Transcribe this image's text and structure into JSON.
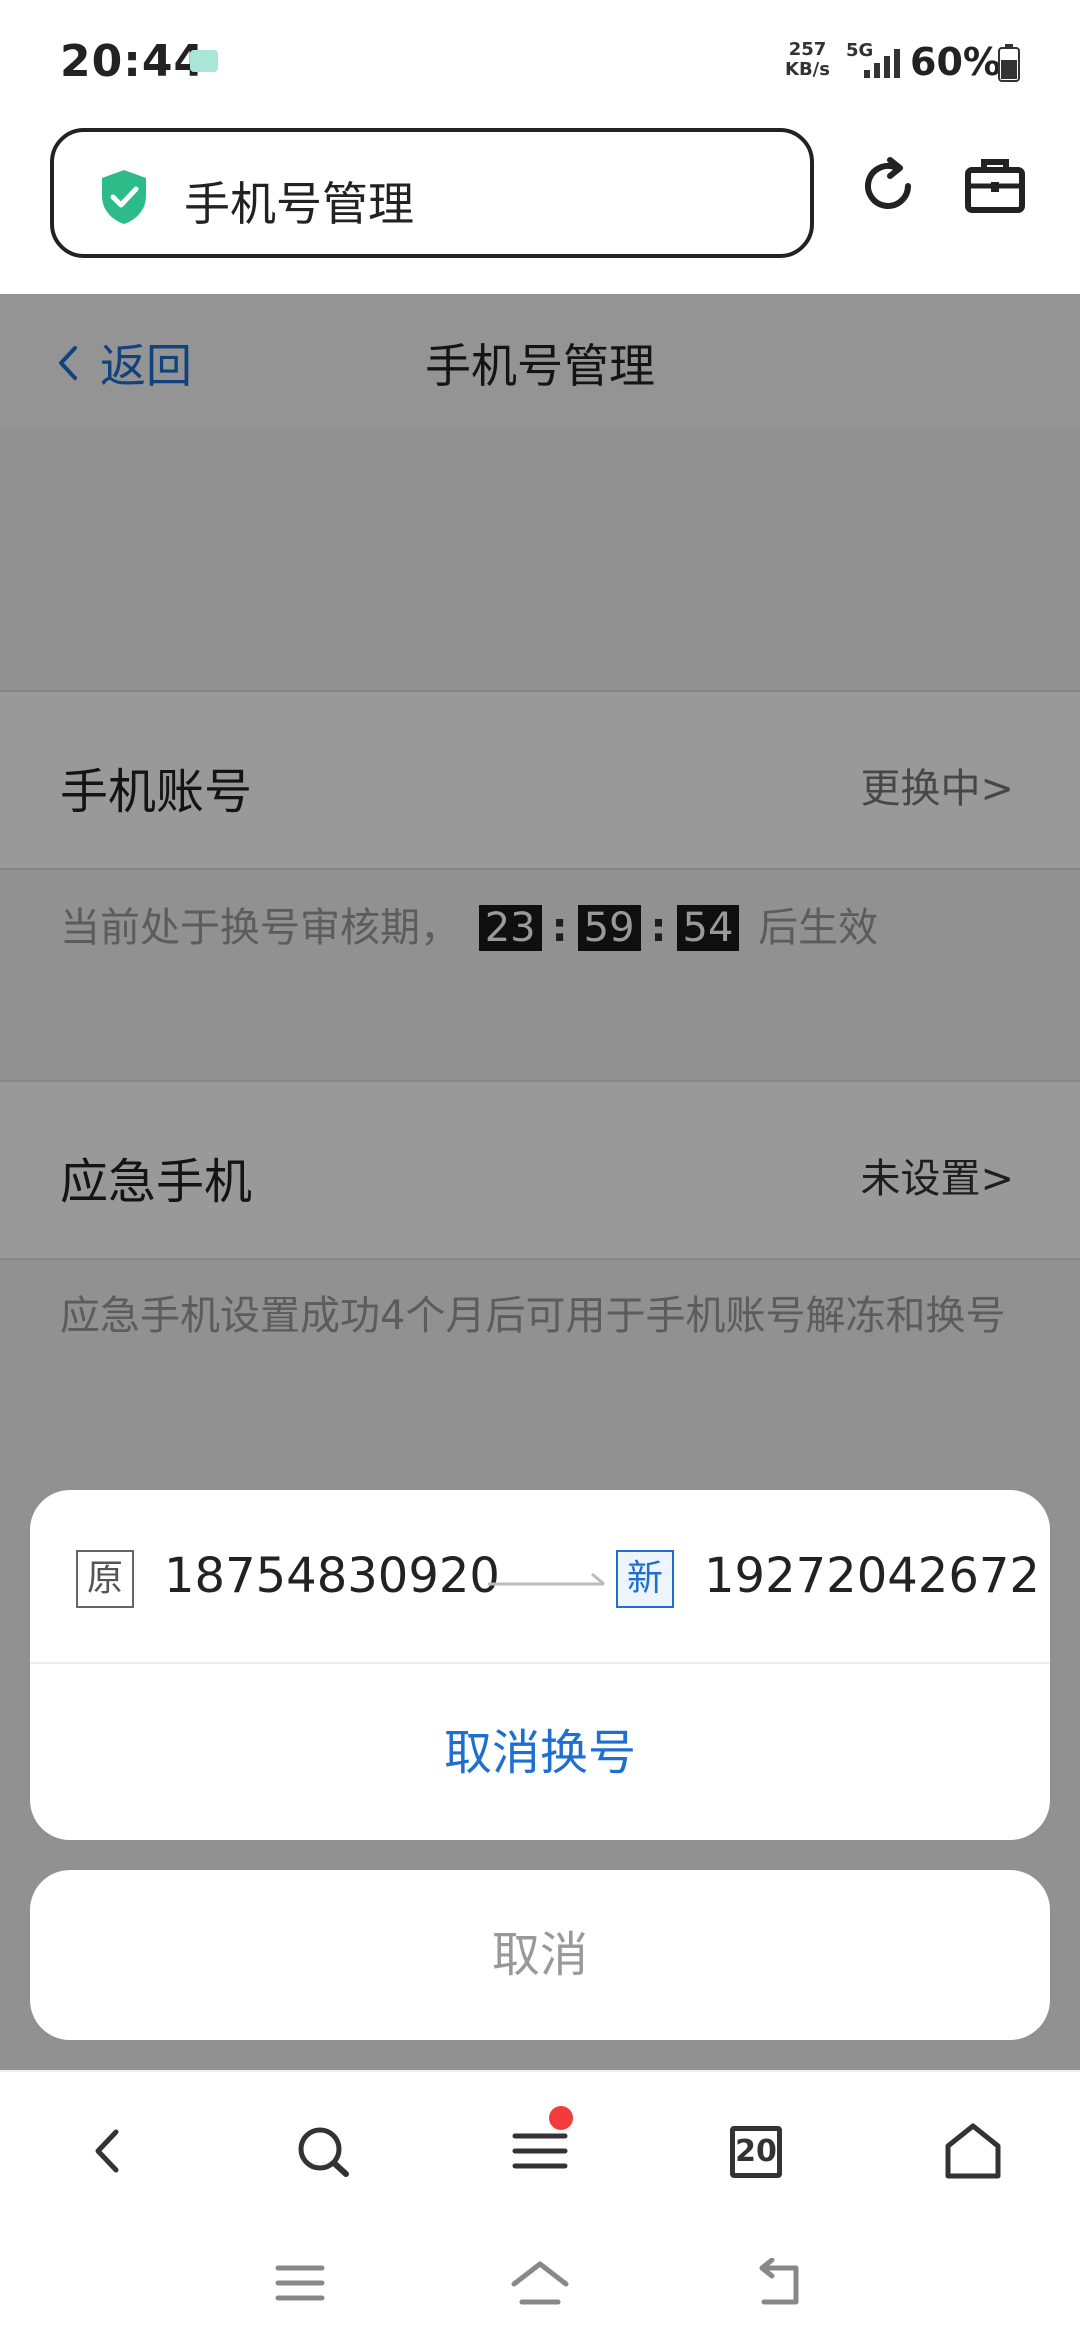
{
  "status_bar": {
    "time": "20:44",
    "net_speed_value": "257",
    "net_speed_unit": "KB/s",
    "network": "5G",
    "battery": "60%"
  },
  "address_bar": {
    "title": "手机号管理",
    "icons": [
      "shield-check-icon",
      "refresh-icon",
      "toolbox-icon"
    ]
  },
  "page": {
    "back_label": "返回",
    "title": "手机号管理",
    "phone_account": {
      "label": "手机账号",
      "status": "更换中>",
      "hint_prefix": "当前处于换号审核期，",
      "countdown": {
        "hours": "23",
        "minutes": "59",
        "seconds": "54"
      },
      "hint_suffix": "后生效"
    },
    "emergency_phone": {
      "label": "应急手机",
      "status": "未设置>",
      "hint": "应急手机设置成功4个月后可用于手机账号解冻和换号"
    }
  },
  "action_sheet": {
    "old_tag": "原",
    "old_number": "18754830920",
    "new_tag": "新",
    "new_number": "19272042672",
    "cancel_change_label": "取消换号",
    "cancel_label": "取消"
  },
  "bottom_bar": {
    "tab_count": "20",
    "icons": [
      "back-icon",
      "search-icon",
      "menu-icon",
      "tabs-icon",
      "home-icon"
    ]
  },
  "colors": {
    "accent": "#1f6fd1",
    "shield": "#2dbb8a",
    "notification_dot": "#f23b3b"
  }
}
